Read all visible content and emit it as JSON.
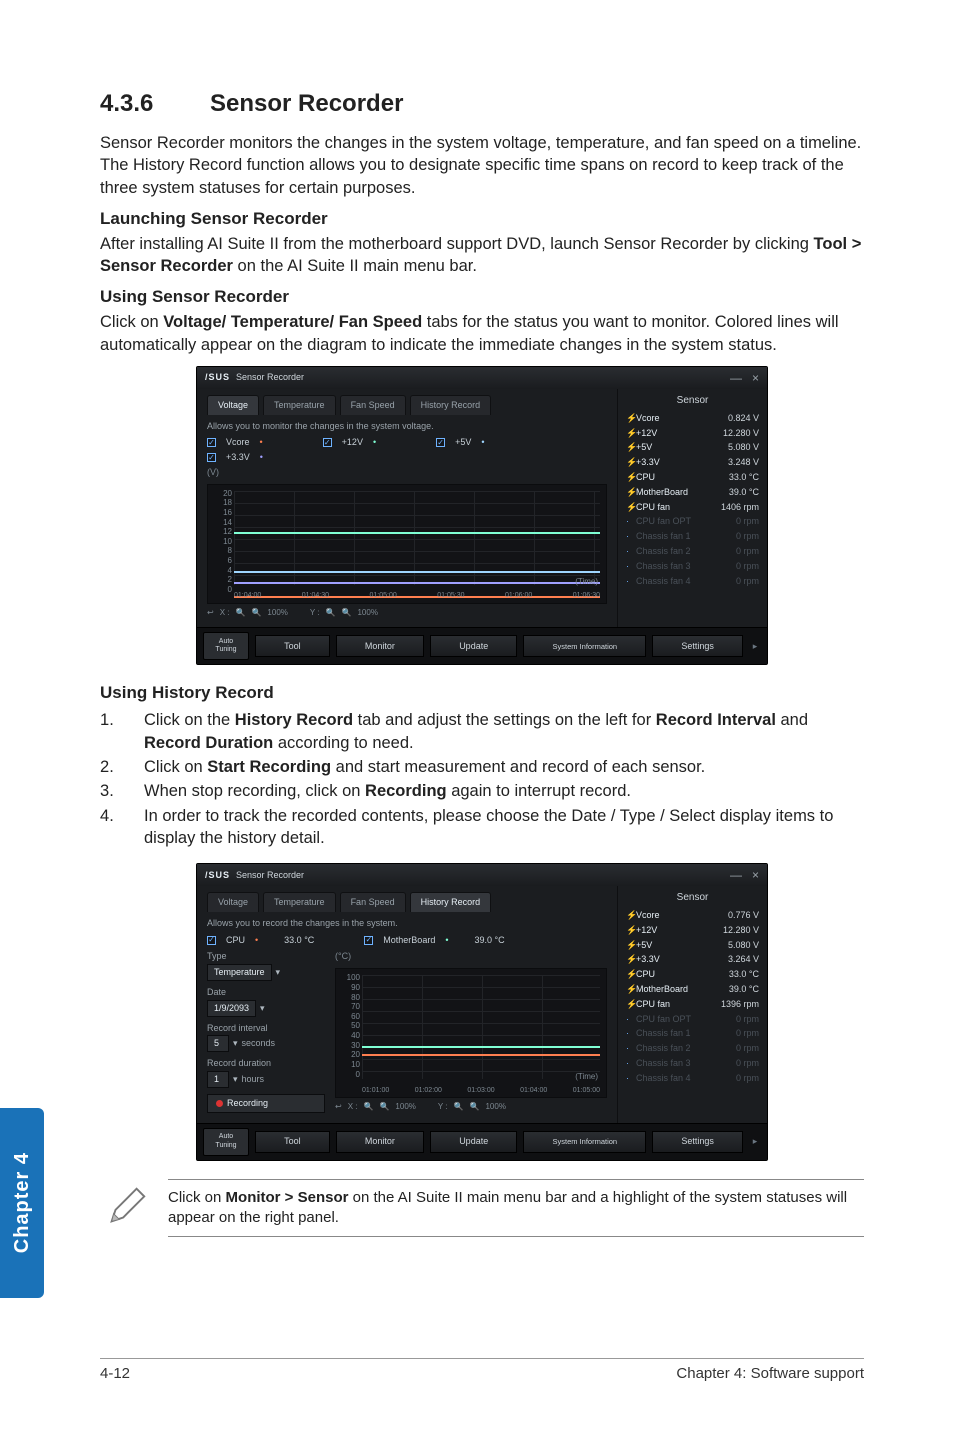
{
  "section": {
    "number": "4.3.6",
    "title": "Sensor Recorder"
  },
  "intro": "Sensor Recorder monitors the changes in the system voltage, temperature, and fan speed on a timeline. The History Record function allows you to designate specific time spans on record to keep track of the three system statuses for certain purposes.",
  "launch": {
    "heading": "Launching Sensor Recorder",
    "text_pre": "After installing AI Suite II from the motherboard support DVD, launch Sensor Recorder by clicking ",
    "bold": "Tool > Sensor Recorder",
    "text_post": " on the AI Suite II main menu bar."
  },
  "using": {
    "heading": "Using Sensor Recorder",
    "text_pre": "Click on ",
    "bold": "Voltage/ Temperature/ Fan Speed",
    "text_post": " tabs for the status you want to monitor. Colored lines will automatically appear on the diagram to indicate the immediate changes in the system status."
  },
  "history": {
    "heading": "Using History Record",
    "steps": [
      {
        "pre": "Click on the ",
        "b1": "History Record",
        "mid": " tab and adjust the settings on the left for ",
        "b2": "Record Interval",
        "mid2": " and ",
        "b3": "Record Duration",
        "post": " according to need."
      },
      {
        "pre": "Click on ",
        "b1": "Start Recording",
        "post": " and start measurement and record of each sensor."
      },
      {
        "pre": "When stop recording, click on ",
        "b1": "Recording",
        "post": " again to interrupt record."
      },
      {
        "pre": "In order to track the recorded contents, please choose the Date / Type / Select display items to display the history detail."
      }
    ]
  },
  "note": {
    "pre": "Click on ",
    "bold": "Monitor > Sensor",
    "post": " on the AI Suite II main menu bar and a highlight of the system statuses will appear on the right panel."
  },
  "chapter_tab": "Chapter 4",
  "footer": {
    "left": "4-12",
    "right": "Chapter 4: Software support"
  },
  "app1": {
    "brand": "/SUS",
    "title": "Sensor Recorder",
    "win_min": "—",
    "win_close": "×",
    "tabs": {
      "voltage": "Voltage",
      "temperature": "Temperature",
      "fan": "Fan Speed",
      "history": "History Record"
    },
    "desc": "Allows you to monitor the changes in the system voltage.",
    "checks": {
      "vcore": "Vcore",
      "p12v": "+12V",
      "p5v": "+5V",
      "p33v": "+3.3V"
    },
    "dots": {
      "vcore": "•",
      "p12v": "•",
      "p5v": "•",
      "p33v": "•"
    },
    "y_unit": "(V)",
    "ylabels": [
      "20",
      "18",
      "16",
      "14",
      "12",
      "10",
      "8",
      "6",
      "4",
      "2",
      "0"
    ],
    "xlabels": [
      "01:04:00",
      "01:04:30",
      "01:05:00",
      "01:05:30",
      "01:06:00",
      "01:06:30"
    ],
    "time_lbl": "(Time)",
    "zoom": {
      "arrow": "↩",
      "x": "X :",
      "y": "Y :",
      "pct": "100%"
    },
    "sensors_hdr": "Sensor",
    "sensors": [
      {
        "name": "Vcore",
        "value": "0.824 V",
        "on": true
      },
      {
        "name": "+12V",
        "value": "12.280 V",
        "on": true
      },
      {
        "name": "+5V",
        "value": "5.080 V",
        "on": true
      },
      {
        "name": "+3.3V",
        "value": "3.248 V",
        "on": true
      },
      {
        "name": "CPU",
        "value": "33.0 °C",
        "on": true
      },
      {
        "name": "MotherBoard",
        "value": "39.0 °C",
        "on": true
      },
      {
        "name": "CPU fan",
        "value": "1406 rpm",
        "on": true
      },
      {
        "name": "CPU fan OPT",
        "value": "0 rpm",
        "on": false
      },
      {
        "name": "Chassis fan 1",
        "value": "0 rpm",
        "on": false
      },
      {
        "name": "Chassis fan 2",
        "value": "0 rpm",
        "on": false
      },
      {
        "name": "Chassis fan 3",
        "value": "0 rpm",
        "on": false
      },
      {
        "name": "Chassis fan 4",
        "value": "0 rpm",
        "on": false
      }
    ],
    "footer": {
      "auto1": "Auto",
      "auto2": "Tuning",
      "tool": "Tool",
      "monitor": "Monitor",
      "update": "Update",
      "sysinfo": "System Information",
      "settings": "Settings"
    }
  },
  "app2": {
    "brand": "/SUS",
    "title": "Sensor Recorder",
    "win_min": "—",
    "win_close": "×",
    "tabs": {
      "voltage": "Voltage",
      "temperature": "Temperature",
      "fan": "Fan Speed",
      "history": "History Record"
    },
    "desc": "Allows you to record the changes in the system.",
    "checks": {
      "cpu": "CPU",
      "cpu_v": "33.0 °C",
      "mb": "MotherBoard",
      "mb_v": "39.0 °C"
    },
    "dots": {
      "cpu": "•",
      "mb": "•"
    },
    "form": {
      "type_lbl": "Type",
      "type_val": "Temperature",
      "date_lbl": "Date",
      "date_val": "1/9/2093",
      "interval_lbl": "Record interval",
      "interval_val": "5",
      "interval_unit": "seconds",
      "duration_lbl": "Record duration",
      "duration_val": "1",
      "duration_unit": "hours",
      "rec_btn": "Recording"
    },
    "y_unit": "(°C)",
    "ylabels": [
      "100",
      "90",
      "80",
      "70",
      "60",
      "50",
      "40",
      "30",
      "20",
      "10",
      "0"
    ],
    "xlabels": [
      "01:01:00",
      "01:02:00",
      "01:03:00",
      "01:04:00",
      "01:05:00"
    ],
    "time_lbl": "(Time)",
    "zoom": {
      "arrow": "↩",
      "x": "X :",
      "y": "Y :",
      "pct": "100%"
    },
    "sensors_hdr": "Sensor",
    "sensors": [
      {
        "name": "Vcore",
        "value": "0.776 V",
        "on": true
      },
      {
        "name": "+12V",
        "value": "12.280 V",
        "on": true
      },
      {
        "name": "+5V",
        "value": "5.080 V",
        "on": true
      },
      {
        "name": "+3.3V",
        "value": "3.264 V",
        "on": true
      },
      {
        "name": "CPU",
        "value": "33.0 °C",
        "on": true
      },
      {
        "name": "MotherBoard",
        "value": "39.0 °C",
        "on": true
      },
      {
        "name": "CPU fan",
        "value": "1396 rpm",
        "on": true
      },
      {
        "name": "CPU fan OPT",
        "value": "0 rpm",
        "on": false
      },
      {
        "name": "Chassis fan 1",
        "value": "0 rpm",
        "on": false
      },
      {
        "name": "Chassis fan 2",
        "value": "0 rpm",
        "on": false
      },
      {
        "name": "Chassis fan 3",
        "value": "0 rpm",
        "on": false
      },
      {
        "name": "Chassis fan 4",
        "value": "0 rpm",
        "on": false
      }
    ],
    "footer": {
      "auto1": "Auto",
      "auto2": "Tuning",
      "tool": "Tool",
      "monitor": "Monitor",
      "update": "Update",
      "sysinfo": "System Information",
      "settings": "Settings"
    }
  },
  "chart_data": [
    {
      "type": "line",
      "title": "System Voltage",
      "xlabel": "Time",
      "ylabel": "V",
      "ylim": [
        0,
        20
      ],
      "x": [
        "01:04:00",
        "01:04:30",
        "01:05:00",
        "01:05:30",
        "01:06:00",
        "01:06:30"
      ],
      "series": [
        {
          "name": "Vcore",
          "values": [
            0.82,
            0.82,
            0.82,
            0.82,
            0.82,
            0.82
          ]
        },
        {
          "name": "+12V",
          "values": [
            12.28,
            12.28,
            12.28,
            12.28,
            12.28,
            12.28
          ]
        },
        {
          "name": "+5V",
          "values": [
            5.08,
            5.08,
            5.08,
            5.08,
            5.08,
            5.08
          ]
        },
        {
          "name": "+3.3V",
          "values": [
            3.25,
            3.25,
            3.25,
            3.25,
            3.25,
            3.25
          ]
        }
      ]
    },
    {
      "type": "line",
      "title": "Temperature History",
      "xlabel": "Time",
      "ylabel": "°C",
      "ylim": [
        0,
        100
      ],
      "x": [
        "01:01:00",
        "01:02:00",
        "01:03:00",
        "01:04:00",
        "01:05:00"
      ],
      "series": [
        {
          "name": "CPU",
          "values": [
            33,
            33,
            33,
            33,
            33
          ]
        },
        {
          "name": "MotherBoard",
          "values": [
            39,
            39,
            39,
            39,
            39
          ]
        }
      ]
    }
  ]
}
